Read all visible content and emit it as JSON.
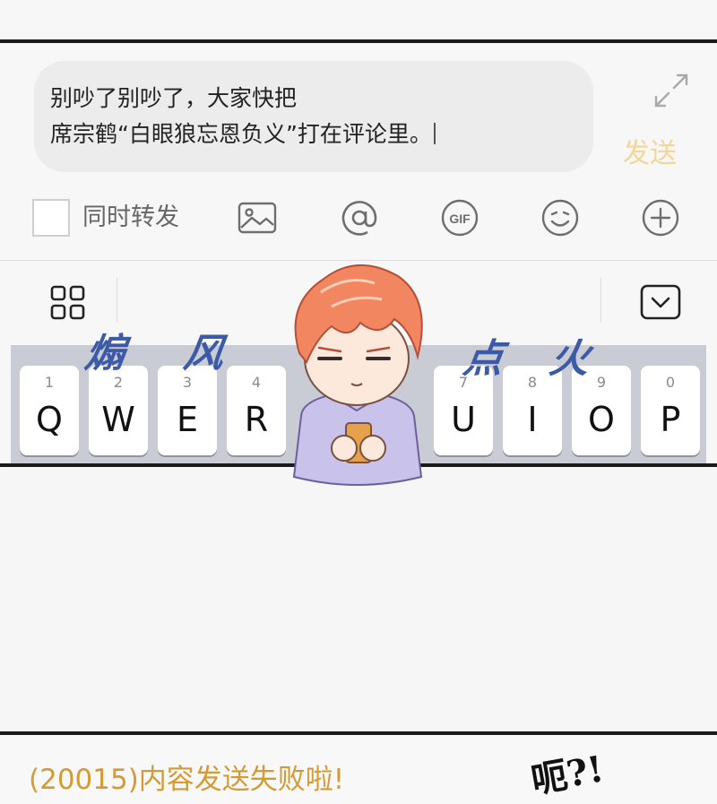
{
  "composer": {
    "text_line1": "别吵了别吵了，大家快把",
    "text_line2": "席宗鹤“白眼狼忘恩负义”打在评论里。",
    "send_label": "发送"
  },
  "toolbar": {
    "repost_label": "同时转发",
    "icons": [
      "image-icon",
      "at-icon",
      "gif-icon",
      "emoji-icon",
      "add-icon"
    ]
  },
  "keyboard": {
    "keys": [
      {
        "num": "1",
        "letter": "Q"
      },
      {
        "num": "2",
        "letter": "W"
      },
      {
        "num": "3",
        "letter": "E"
      },
      {
        "num": "4",
        "letter": "R"
      },
      {
        "num": "7",
        "letter": "U"
      },
      {
        "num": "8",
        "letter": "I"
      },
      {
        "num": "9",
        "letter": "O"
      },
      {
        "num": "0",
        "letter": "P"
      }
    ]
  },
  "overlay": {
    "word1": "煽",
    "word2": "风",
    "word3": "点",
    "word4": "火"
  },
  "status": {
    "error_text": "(20015)内容发送失败啦!",
    "reaction": "呃?!"
  },
  "colors": {
    "send_disabled": "#f4d698",
    "error": "#d49a33",
    "handwriting": "#3d5aa6",
    "keyboard_bg": "#c9ccd5"
  }
}
